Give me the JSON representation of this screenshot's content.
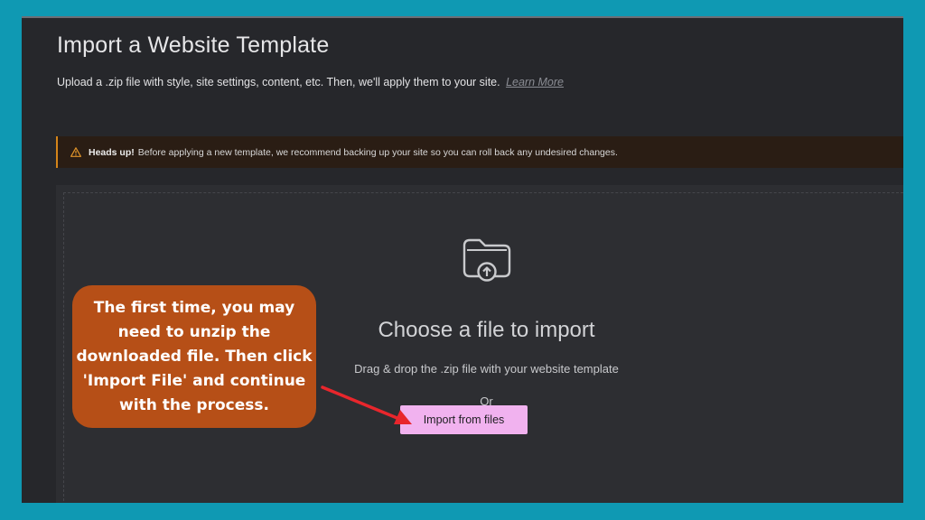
{
  "header": {
    "title": "Import a Website Template",
    "subtitle": "Upload a .zip file with style, site settings, content, etc. Then, we'll apply them to your site.",
    "learn_more": "Learn More"
  },
  "notice": {
    "icon": "warning-icon",
    "strong": "Heads up!",
    "text": "Before applying a new template, we recommend backing up your site so you can roll back any undesired changes.",
    "accent_color": "#d4851a"
  },
  "dropzone": {
    "icon": "folder-upload-icon",
    "title": "Choose a file to import",
    "description": "Drag & drop the .zip file with your website template",
    "or": "Or",
    "button": "Import from files",
    "button_color": "#f1b2ef"
  },
  "callout": {
    "text": "The first time, you may need to unzip the downloaded file. Then click 'Import File' and continue with the process.",
    "color": "#b64f17"
  },
  "colors": {
    "frame": "#0f99b3",
    "background": "#26272b",
    "arrow": "#e8262c"
  }
}
